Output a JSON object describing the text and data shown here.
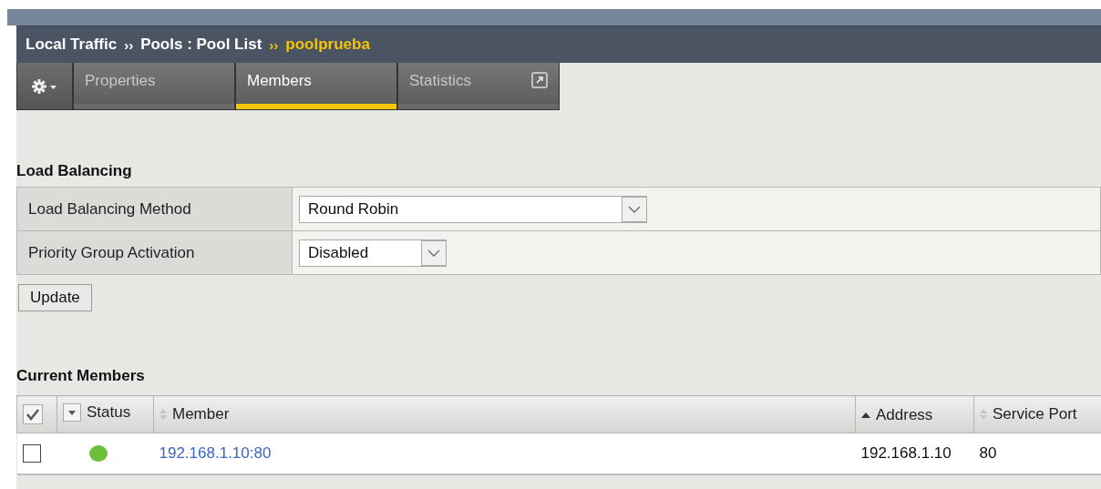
{
  "breadcrumb": [
    {
      "label": "Local Traffic",
      "current": false
    },
    {
      "separator": "››",
      "label": "Pools : Pool List",
      "current": false
    },
    {
      "separator": "››",
      "label": "poolprueba",
      "current": true
    }
  ],
  "tabs": [
    {
      "label": "Properties",
      "selected": false,
      "kind": "plain"
    },
    {
      "label": "Members",
      "selected": true,
      "kind": "plain"
    },
    {
      "label": "Statistics",
      "selected": false,
      "kind": "popout"
    }
  ],
  "load_balancing": {
    "title": "Load Balancing",
    "fields": [
      {
        "label": "Load Balancing Method",
        "value": "Round Robin",
        "kind": "wide"
      },
      {
        "label": "Priority Group Activation",
        "value": "Disabled",
        "kind": "narrow"
      }
    ],
    "button": "Update"
  },
  "members": {
    "title": "Current Members",
    "columns": [
      {
        "label": "Status",
        "kind": "menu"
      },
      {
        "label": "Member",
        "kind": "sortable"
      },
      {
        "label": "Address",
        "kind": "ascending"
      },
      {
        "label": "Service Port",
        "kind": "sortable"
      }
    ],
    "rows": [
      {
        "selected": false,
        "color": "#6cbf3a",
        "member": "192.168.1.10:80",
        "address": "192.168.1.10",
        "port": "80"
      }
    ]
  }
}
